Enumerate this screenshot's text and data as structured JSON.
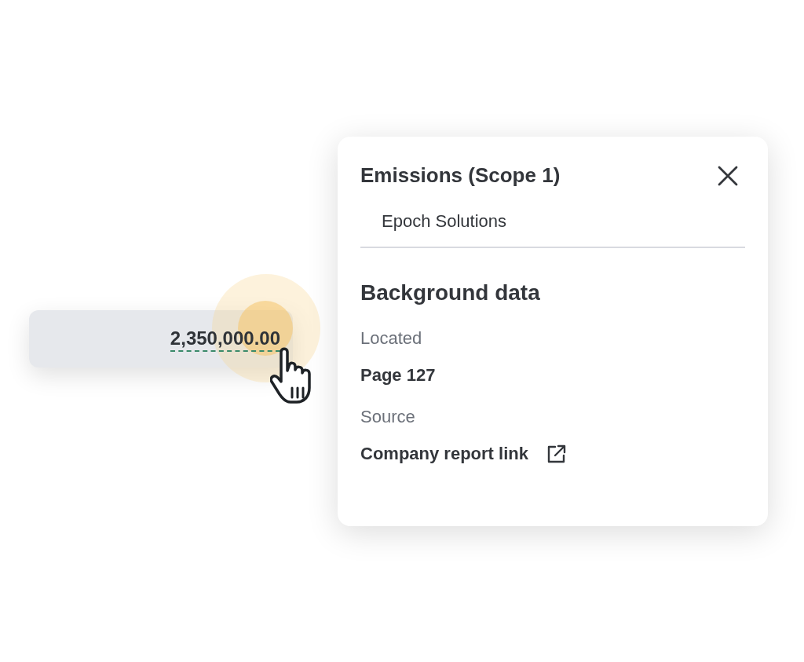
{
  "value_cell": {
    "value": "2,350,000.00"
  },
  "popup": {
    "title": "Emissions (Scope 1)",
    "subtitle": "Epoch Solutions",
    "section_title": "Background data",
    "fields": [
      {
        "label": "Located",
        "value": "Page 127",
        "kind": "text"
      },
      {
        "label": "Source",
        "value": "Company report link",
        "kind": "link"
      }
    ]
  }
}
